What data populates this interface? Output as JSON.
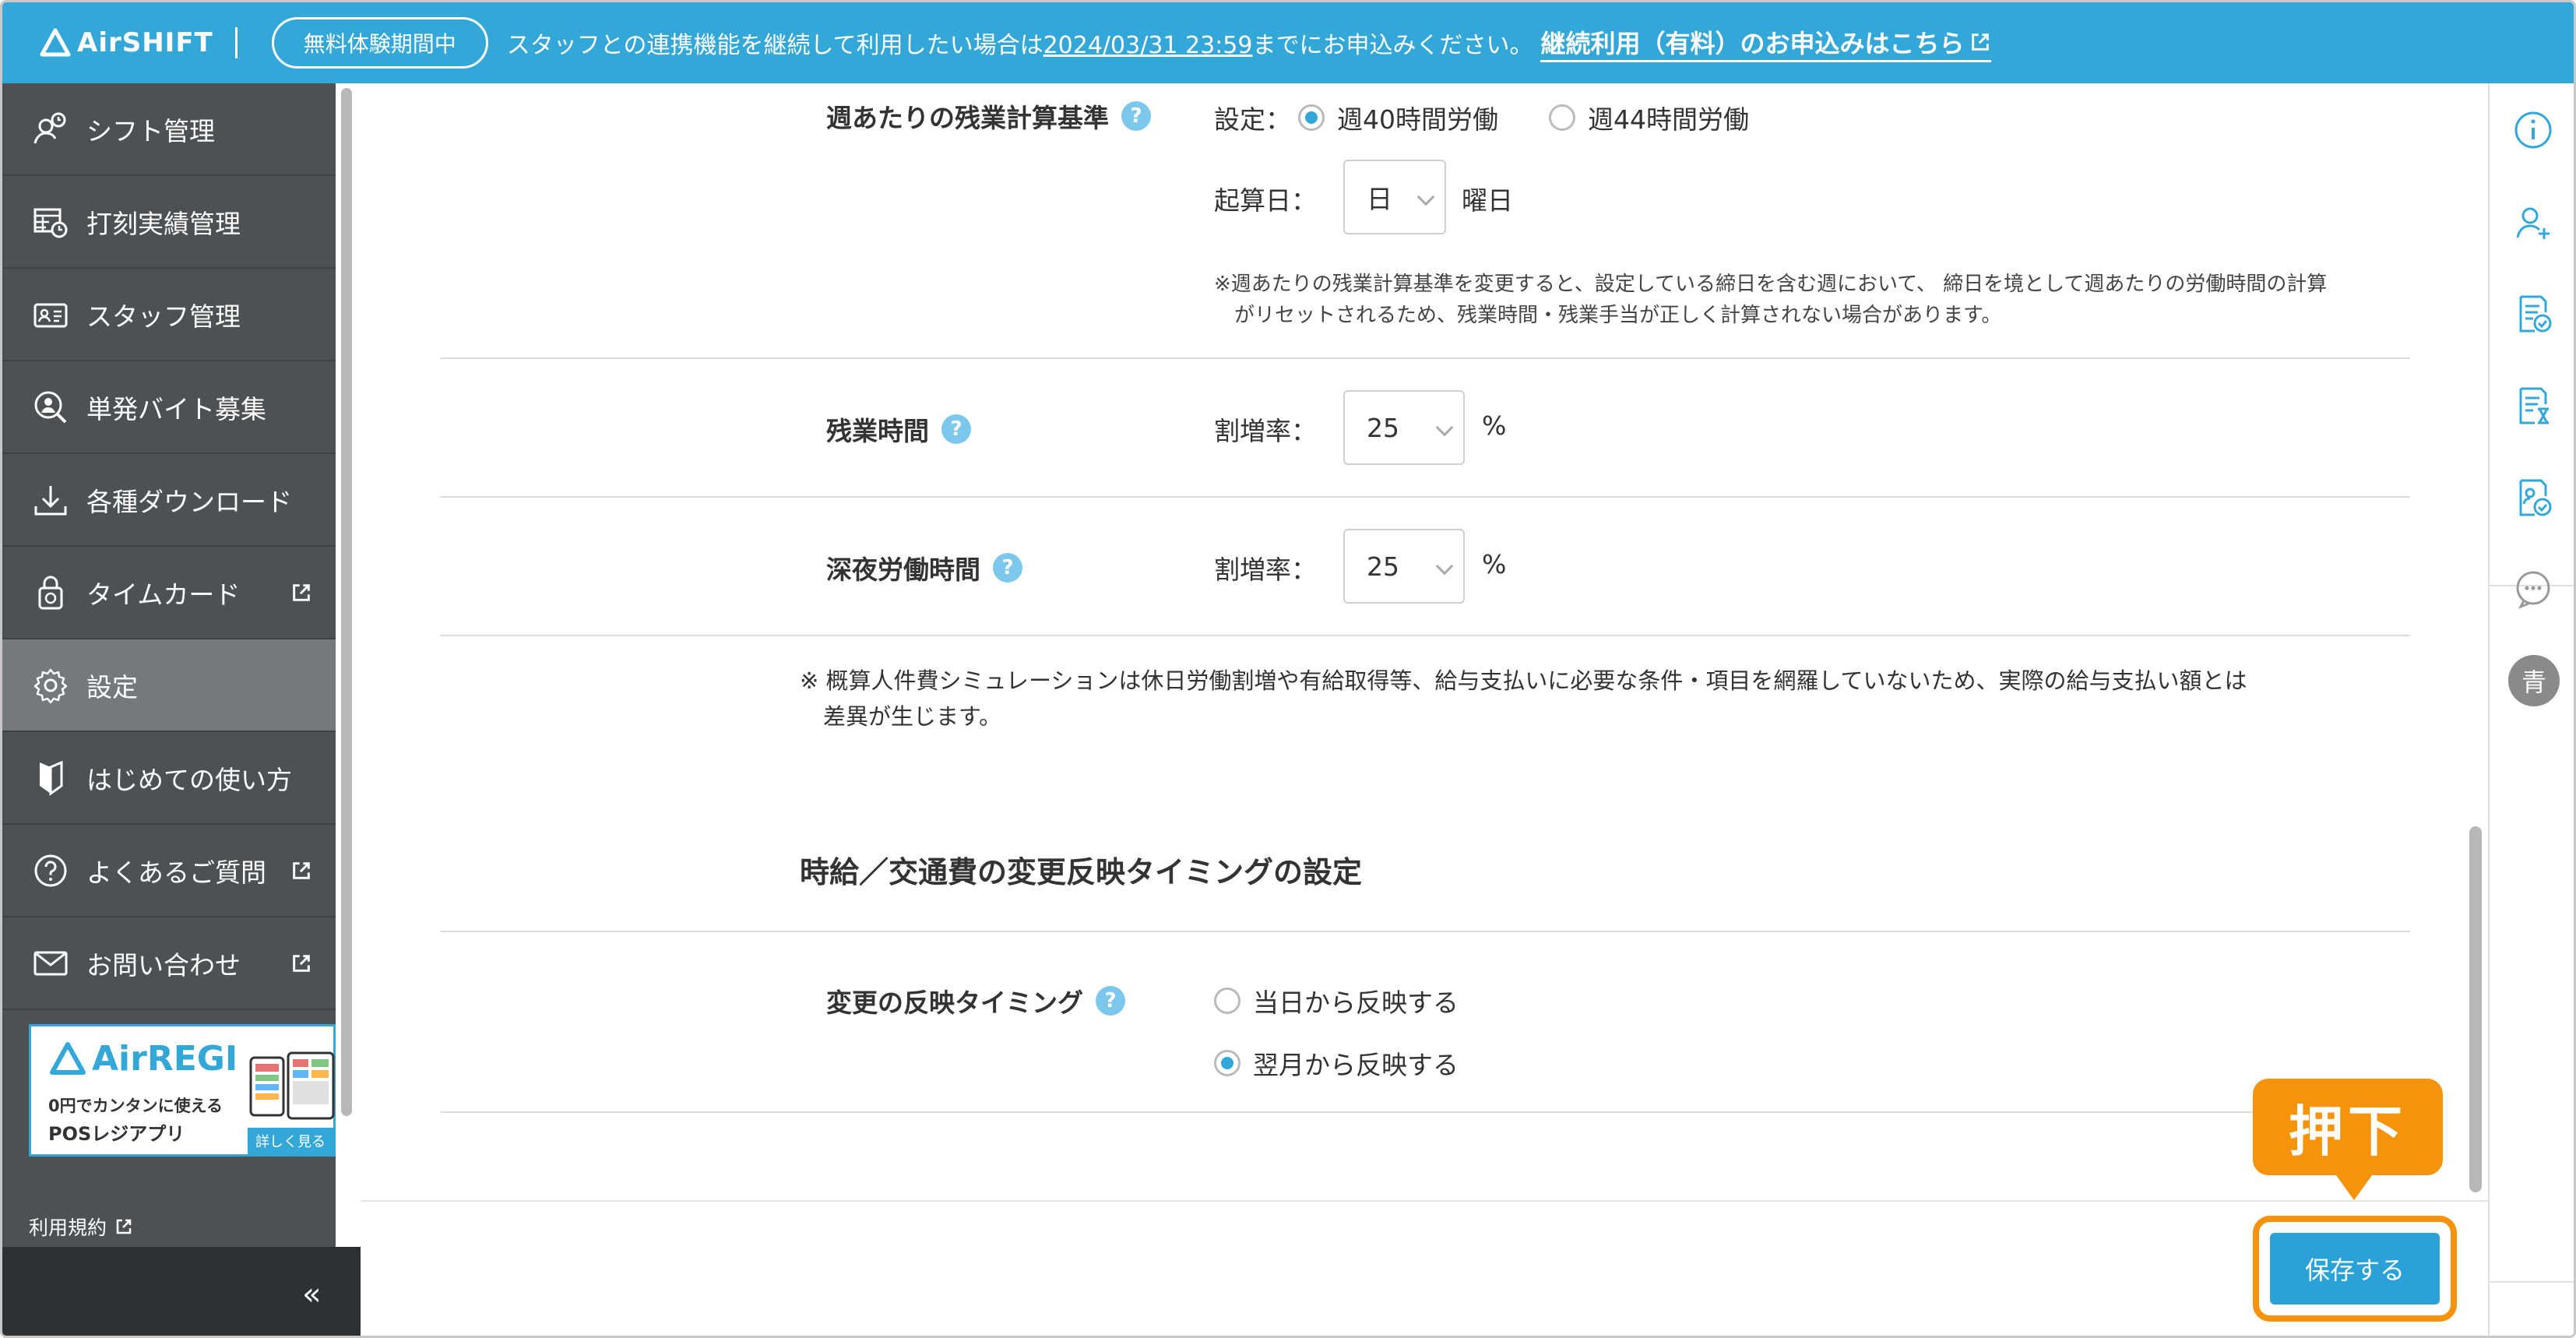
{
  "topbar": {
    "app_name": "AirSHIFT",
    "trial_badge": "無料体験期間中",
    "trial_msg_pre": "スタッフとの連携機能を継続して利用したい場合は",
    "trial_deadline": "2024/03/31 23:59",
    "trial_msg_post": "までにお申込みください。",
    "trial_link": "継続利用（有料）のお申込みはこちら"
  },
  "sidebar": {
    "items": [
      {
        "label": "シフト管理",
        "icon": "shift-icon"
      },
      {
        "label": "打刻実績管理",
        "icon": "timesheet-icon"
      },
      {
        "label": "スタッフ管理",
        "icon": "staff-card-icon"
      },
      {
        "label": "単発バイト募集",
        "icon": "person-search-icon"
      },
      {
        "label": "各種ダウンロード",
        "icon": "download-icon"
      },
      {
        "label": "タイムカード",
        "icon": "lock-clock-icon"
      },
      {
        "label": "設定",
        "icon": "gear-icon"
      },
      {
        "label": "はじめての使い方",
        "icon": "beginner-icon"
      },
      {
        "label": "よくあるご質問",
        "icon": "question-icon"
      },
      {
        "label": "お問い合わせ",
        "icon": "mail-icon"
      }
    ],
    "promo": {
      "brand": "AirREGI",
      "line1": "0円でカンタンに使える",
      "line2": "POSレジアプリ",
      "more": "詳しく見る"
    },
    "terms": "利用規約",
    "collapse": "«"
  },
  "main": {
    "weekly_overtime": {
      "label": "週あたりの残業計算基準",
      "setting_label": "設定：",
      "option_40": "週40時間労働",
      "option_44": "週44時間労働",
      "selected": "週40時間労働",
      "start_day_label": "起算日：",
      "start_day_value": "日",
      "start_day_suffix": "曜日",
      "note_line1": "※週あたりの残業計算基準を変更すると、設定している締日を含む週において、 締日を境として週あたりの労働時間の計算",
      "note_line2": "がリセットされるため、残業時間・残業手当が正しく計算されない場合があります。"
    },
    "overtime": {
      "label": "残業時間",
      "rate_label": "割増率：",
      "rate_value": "25",
      "unit": "%"
    },
    "night": {
      "label": "深夜労働時間",
      "rate_label": "割増率：",
      "rate_value": "25",
      "unit": "%"
    },
    "simulation_note_line1": "※ 概算人件費シミュレーションは休日労働割増や有給取得等、給与支払いに必要な条件・項目を網羅していないため、実際の給与支払い額とは",
    "simulation_note_line2": "差異が生じます。",
    "timing_section_title": "時給／交通費の変更反映タイミングの設定",
    "timing": {
      "label": "変更の反映タイミング",
      "option_same_day": "当日から反映する",
      "option_next_month": "翌月から反映する",
      "selected": "翌月から反映する"
    }
  },
  "footer": {
    "save_label": "保存する",
    "callout": "押下"
  },
  "rail": {
    "icons": [
      "info-icon",
      "add-user-icon",
      "doc-check-icon",
      "doc-hourglass-icon",
      "doc-badge-icon",
      "chat-icon"
    ],
    "avatar": "青",
    "collapse": "«"
  },
  "colors": {
    "brand": "#34a7d9",
    "sidebar": "#4d5153",
    "highlight": "#f6930d"
  }
}
